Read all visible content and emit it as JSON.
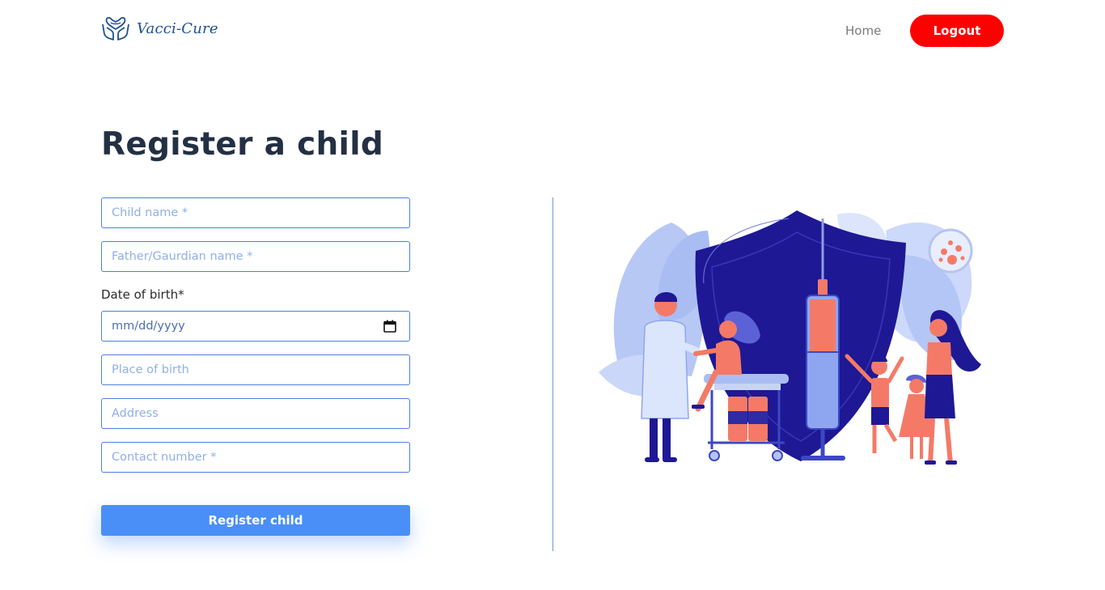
{
  "header": {
    "brand_name": "Vacci-Cure",
    "nav_home": "Home",
    "logout_label": "Logout"
  },
  "page": {
    "title": "Register a child"
  },
  "form": {
    "child_name_placeholder": "Child name *",
    "guardian_name_placeholder": "Father/Gaurdian name *",
    "dob_label": "Date of birth*",
    "dob_placeholder": "mm/dd/yyyy",
    "place_of_birth_placeholder": "Place of birth",
    "address_placeholder": "Address",
    "contact_placeholder": "Contact number *",
    "submit_label": "Register child"
  },
  "colors": {
    "logout_bg": "#ff0000",
    "primary": "#4a8ff7",
    "input_border": "#4e7fdc",
    "brand": "#1f4f96"
  }
}
